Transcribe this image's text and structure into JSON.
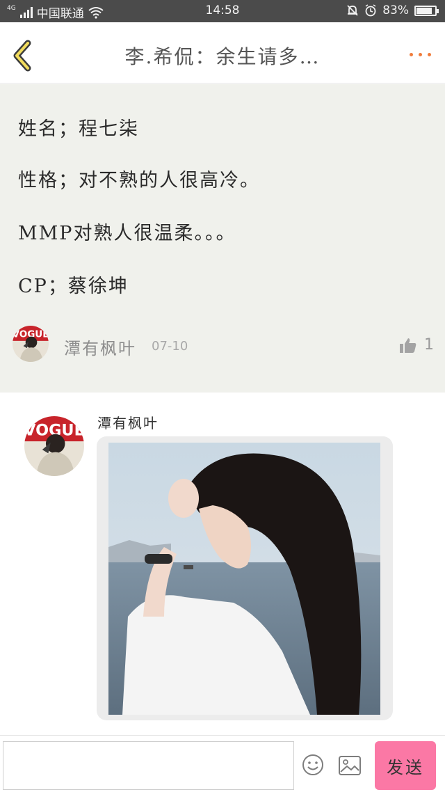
{
  "status_bar": {
    "network": "4G",
    "carrier": "中国联通",
    "time": "14:58",
    "battery_text": "83%",
    "battery_level": 0.83
  },
  "header": {
    "title": "李.希侃：余生请多…",
    "back_icon": "chevron-left-icon",
    "more_icon": "more-dots-icon",
    "accent_color": "#f07c3c"
  },
  "post": {
    "lines": [
      "姓名；程七柒",
      "性格；对不熟的人很高冷。",
      "MMP对熟人很温柔。。。",
      "CP；蔡徐坤"
    ],
    "author": "潭有枫叶",
    "date": "07-10",
    "likes": "1",
    "like_icon": "thumbs-up-icon"
  },
  "reply": {
    "author": "潭有枫叶",
    "photo_icon": "photo-image"
  },
  "composer": {
    "input_value": "",
    "emoji_icon": "smiley-icon",
    "image_icon": "picture-icon",
    "send_label": "发送",
    "send_color": "#fb78a5"
  }
}
